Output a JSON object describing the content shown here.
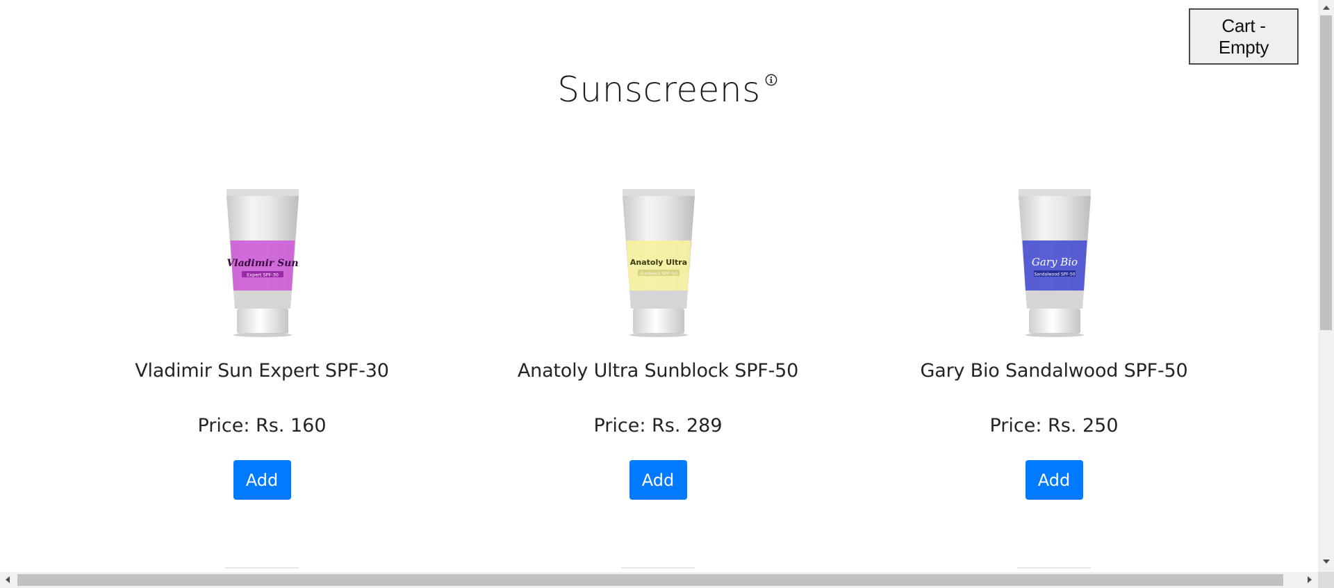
{
  "cart": {
    "label": "Cart - Empty"
  },
  "page": {
    "title": "Sunscreens",
    "info_icon": "info-circle-icon"
  },
  "products": [
    {
      "name": "Vladimir Sun Expert SPF-30",
      "price": "Price: Rs. 160",
      "button": "Add",
      "tube_label": "Vladimir Sun",
      "tube_sublabel": "Expert SPF-30",
      "band_color": "#cf5fd8",
      "sub_band_color": "#9a2aa8"
    },
    {
      "name": "Anatoly Ultra Sunblock SPF-50",
      "price": "Price: Rs. 289",
      "button": "Add",
      "tube_label": "Anatoly Ultra",
      "tube_sublabel": "Sunblock SPF-50",
      "band_color": "#f5f0a2",
      "sub_band_color": "#d8d27a"
    },
    {
      "name": "Gary Bio Sandalwood SPF-50",
      "price": "Price: Rs. 250",
      "button": "Add",
      "tube_label": "Gary Bio",
      "tube_sublabel": "Sandalwood SPF-50",
      "band_color": "#4f56d2",
      "sub_band_color": "#2a2f9a"
    }
  ],
  "colors": {
    "accent": "#007bff"
  }
}
